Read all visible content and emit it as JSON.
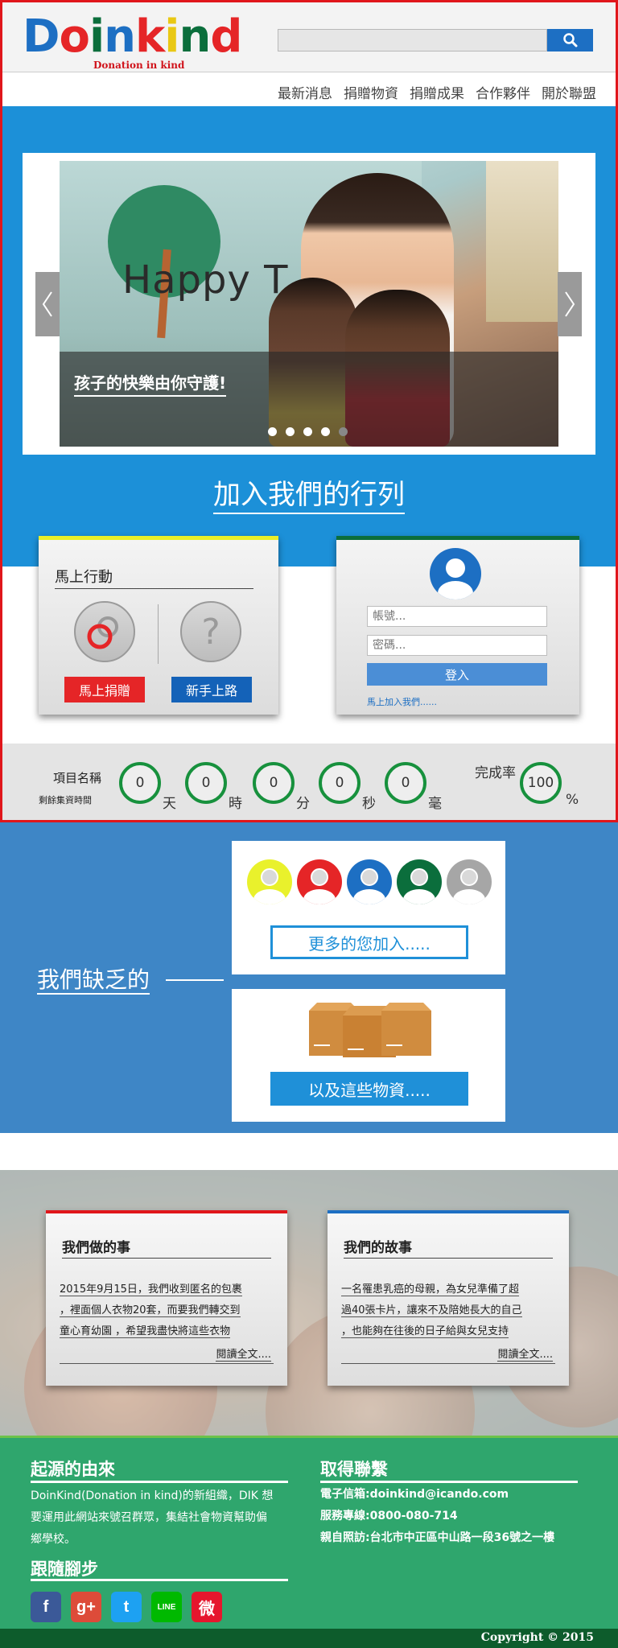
{
  "brand": {
    "logo_letters": [
      "D",
      "o",
      "i",
      "n",
      "k",
      "i",
      "n",
      "d"
    ],
    "logo_colors": [
      "#1d6fc3",
      "#e52527",
      "#0b6e3c",
      "#1d6fc3",
      "#e52527",
      "#e9c814",
      "#0b6e3c",
      "#e52527"
    ],
    "tagline": "Donation in kind"
  },
  "search": {
    "value": "",
    "placeholder": ""
  },
  "nav": [
    "最新消息",
    "捐贈物資",
    "捐贈成果",
    "合作夥伴",
    "開於聯盟"
  ],
  "carousel": {
    "caption": "孩子的快樂由你守護!",
    "wall_text": "Happy T",
    "slides_count": 5,
    "active_index": 4
  },
  "join_title": "加入我們的行列",
  "action_card": {
    "title": "馬上行動",
    "donate_button": "馬上捐贈",
    "newbie_button": "新手上路",
    "question_glyph": "?"
  },
  "login_card": {
    "account_placeholder": "帳號...",
    "password_placeholder": "密碼...",
    "login_button": "登入",
    "join_link": "馬上加入我們......"
  },
  "countdown": {
    "project_label": "項目名稱",
    "remaining_label": "剩餘集資時間",
    "units": [
      {
        "value": "0",
        "unit": "天"
      },
      {
        "value": "0",
        "unit": "時"
      },
      {
        "value": "0",
        "unit": "分"
      },
      {
        "value": "0",
        "unit": "秒"
      },
      {
        "value": "0",
        "unit": "毫"
      }
    ],
    "rate_label": "完成率",
    "rate_value": "100",
    "rate_unit": "%"
  },
  "lack": {
    "title": "我們缺乏的",
    "more_people_button": "更多的您加入.....",
    "more_goods_button": "以及這些物資.....",
    "avatar_colors": [
      "#e9f12c",
      "#e52527",
      "#1d6fc3",
      "#0b6e3c",
      "#a6a6a6"
    ]
  },
  "stories": {
    "left": {
      "title": "我們做的事",
      "lines": [
        "2015年9月15日，我們收到匿名的包裹",
        "，裡面個人衣物20套，而要我們轉交到",
        "童心育幼園 ，希望我盡快將這些衣物"
      ],
      "more": "閱讀全文...."
    },
    "right": {
      "title": "我們的故事",
      "lines": [
        "一名罹患乳癌的母親，為女兒準備了超",
        "過40張卡片，讓來不及陪她長大的自己",
        "，也能夠在往後的日子給與女兒支持"
      ],
      "more": "閱讀全文...."
    }
  },
  "footer": {
    "origin_title": "起源的由來",
    "origin_lines": [
      "DoinKind(Donation in kind)的新組織，DIK 想",
      "要運用此網站來號召群眾，集結社會物資幫助偏",
      "鄉學校。"
    ],
    "follow_title": "跟隨腳步",
    "social": [
      {
        "name": "facebook",
        "glyph": "f",
        "color": "#3b5998"
      },
      {
        "name": "google-plus",
        "glyph": "g+",
        "color": "#dd4b39"
      },
      {
        "name": "twitter",
        "glyph": "t",
        "color": "#1da1f2"
      },
      {
        "name": "line",
        "glyph": "LINE",
        "color": "#00b900"
      },
      {
        "name": "weibo",
        "glyph": "微",
        "color": "#e6162d"
      }
    ],
    "contact_title": "取得聯繫",
    "contact_lines": [
      "電子信箱:doinkind@icando.com",
      "服務專線:0800-080-714",
      "親自照訪:台北市中正區中山路一段36號之一樓"
    ],
    "copyright": "Copyright © 2015"
  }
}
